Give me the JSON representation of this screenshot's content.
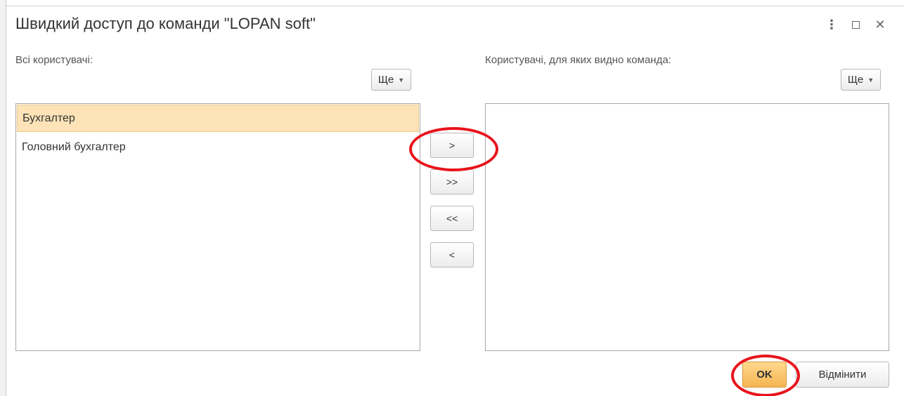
{
  "dialog": {
    "title": "Швидкий доступ до команди \"LOPAN soft\"",
    "controls": {
      "more": "⋮",
      "close": "✕"
    }
  },
  "left_panel": {
    "caption": "Всі користувачі:",
    "more_label": "Ще",
    "items": [
      {
        "label": "Бухгалтер",
        "selected": true
      },
      {
        "label": "Головний бухгалтер",
        "selected": false
      }
    ]
  },
  "right_panel": {
    "caption": "Користувачі, для яких видно команда:",
    "more_label": "Ще",
    "items": []
  },
  "move_buttons": {
    "add": ">",
    "add_all": ">>",
    "remove_all": "<<",
    "remove": "<"
  },
  "footer": {
    "ok_label": "OK",
    "cancel_label": "Відмінити"
  },
  "colors": {
    "selection": "#fde3b7",
    "ok_button": "#f5b452",
    "annotation": "#e8141c"
  }
}
